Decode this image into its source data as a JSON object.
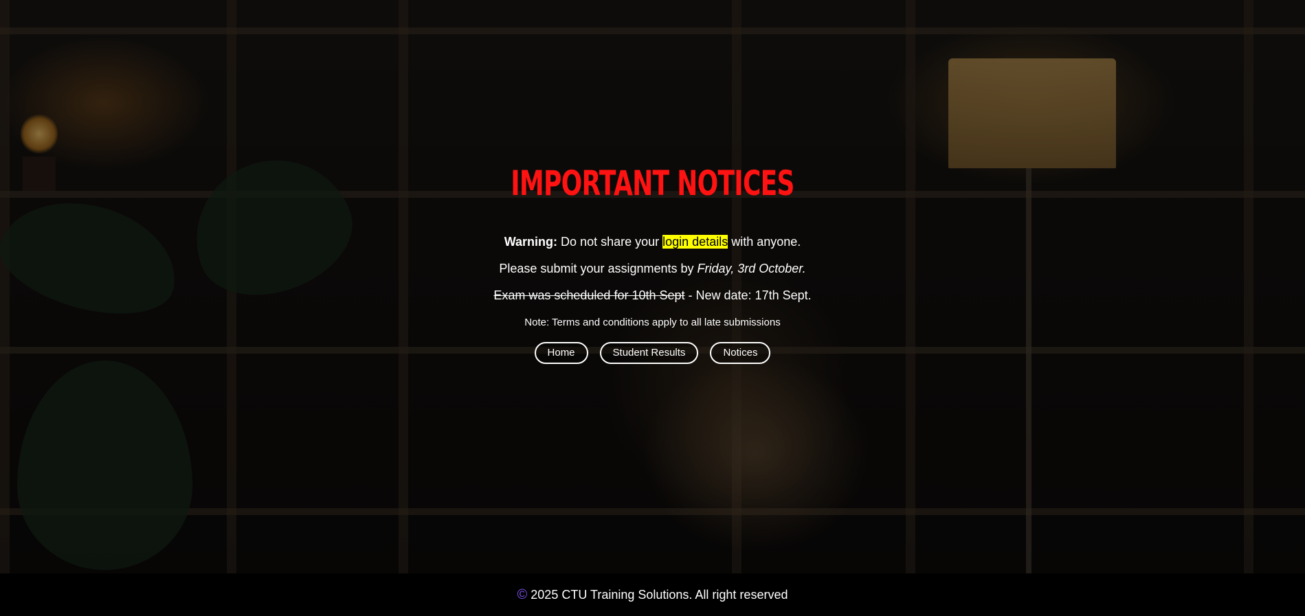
{
  "notices": {
    "title": "Important Notices",
    "warning_label": "Warning:",
    "warning_before": " Do not share your ",
    "warning_highlight": "login details",
    "warning_after": " with anyone.",
    "assignment_text": "Please submit your assignments by ",
    "assignment_date": "Friday, 3rd October.",
    "exam_old": "Exam was scheduled for 10th Sept",
    "exam_new": " - New date: 17th Sept.",
    "note": "Note: Terms and conditions apply to all late submissions"
  },
  "nav": {
    "home": "Home",
    "results": "Student Results",
    "notices": "Notices"
  },
  "footer": {
    "copyright_symbol": "©",
    "text": " 2025 CTU Training Solutions. All right reserved"
  },
  "colors": {
    "title": "#ff1212",
    "highlight": "#ffff00",
    "copyright_icon": "#7b52e6"
  }
}
